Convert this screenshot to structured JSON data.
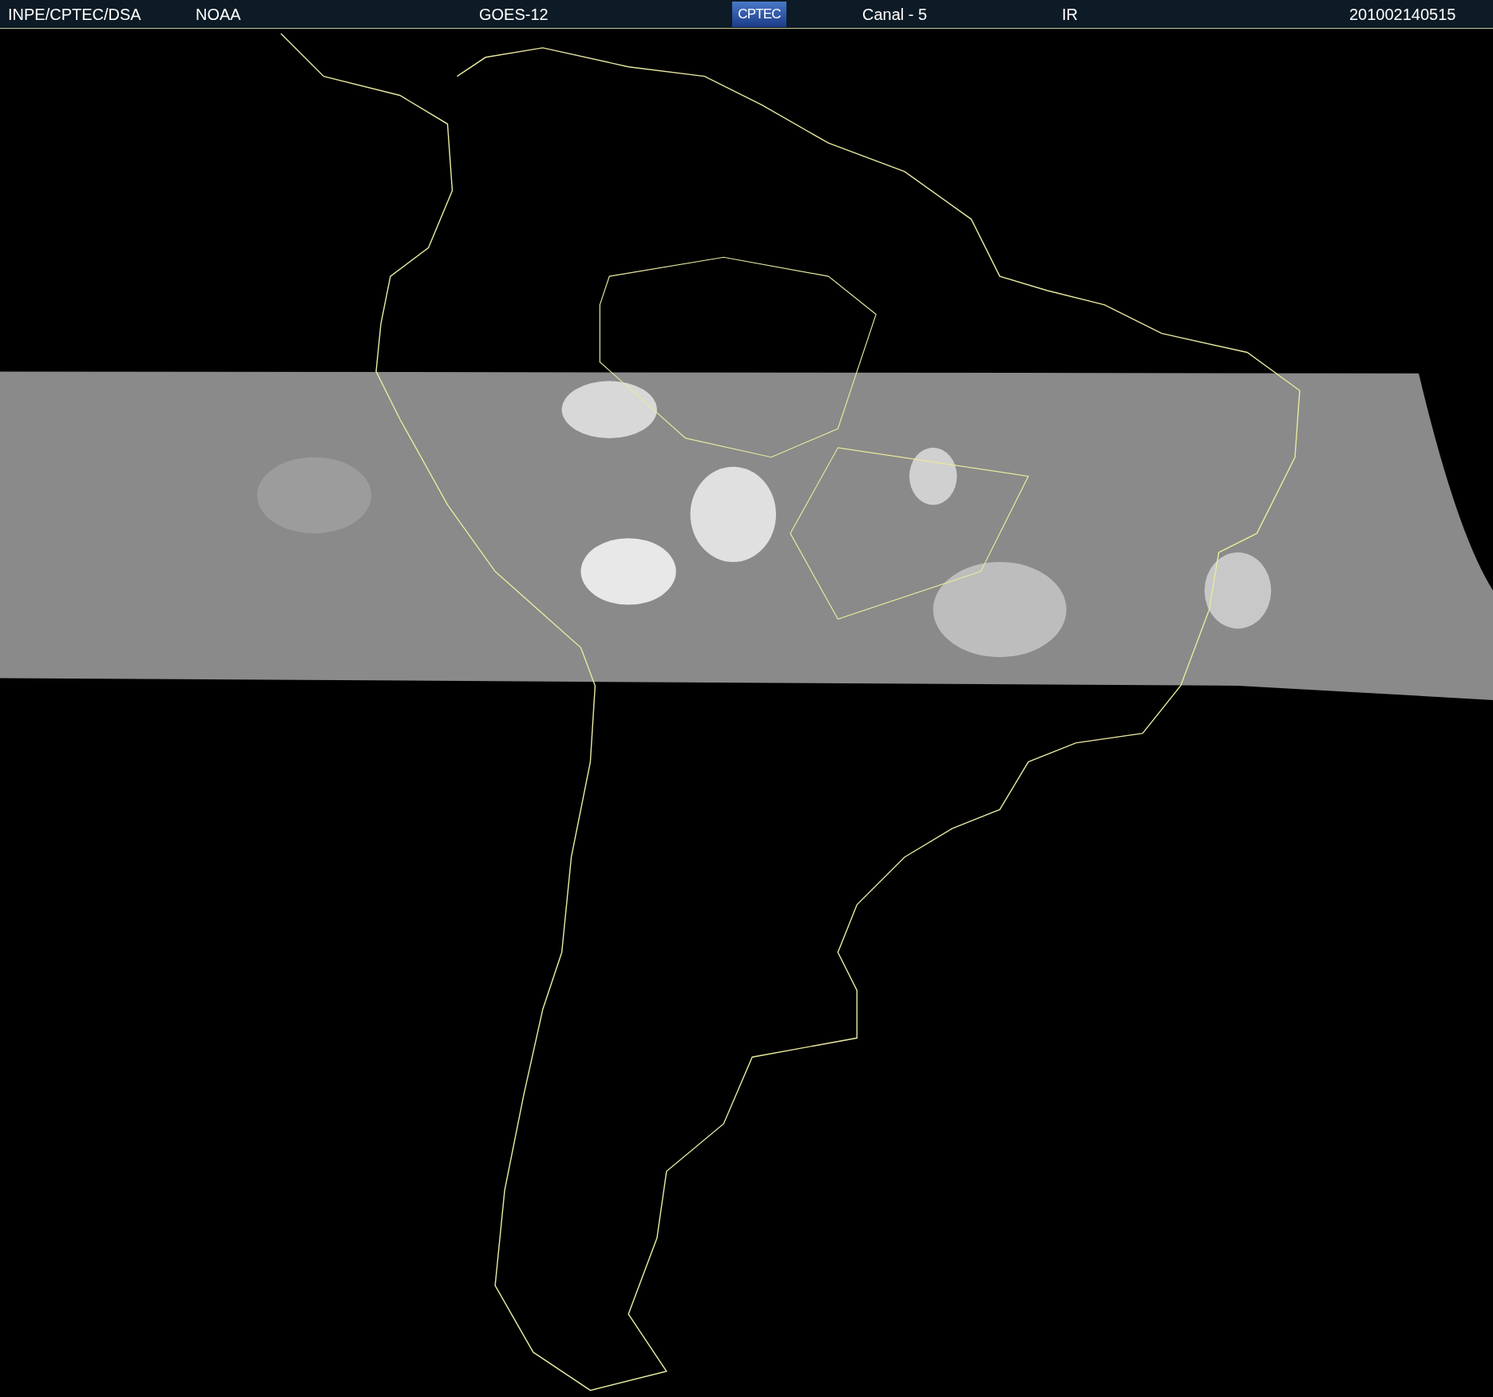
{
  "header": {
    "items": [
      {
        "kind": "text",
        "text": "INPE/CPTEC/DSA"
      },
      {
        "kind": "text",
        "text": "NOAA"
      },
      {
        "kind": "text",
        "text": "GOES-12"
      },
      {
        "kind": "logo",
        "text": "CPTEC"
      },
      {
        "kind": "text",
        "text": "Canal - 5"
      },
      {
        "kind": "text",
        "text": "IR"
      },
      {
        "kind": "text",
        "text": "201002140515"
      }
    ]
  }
}
